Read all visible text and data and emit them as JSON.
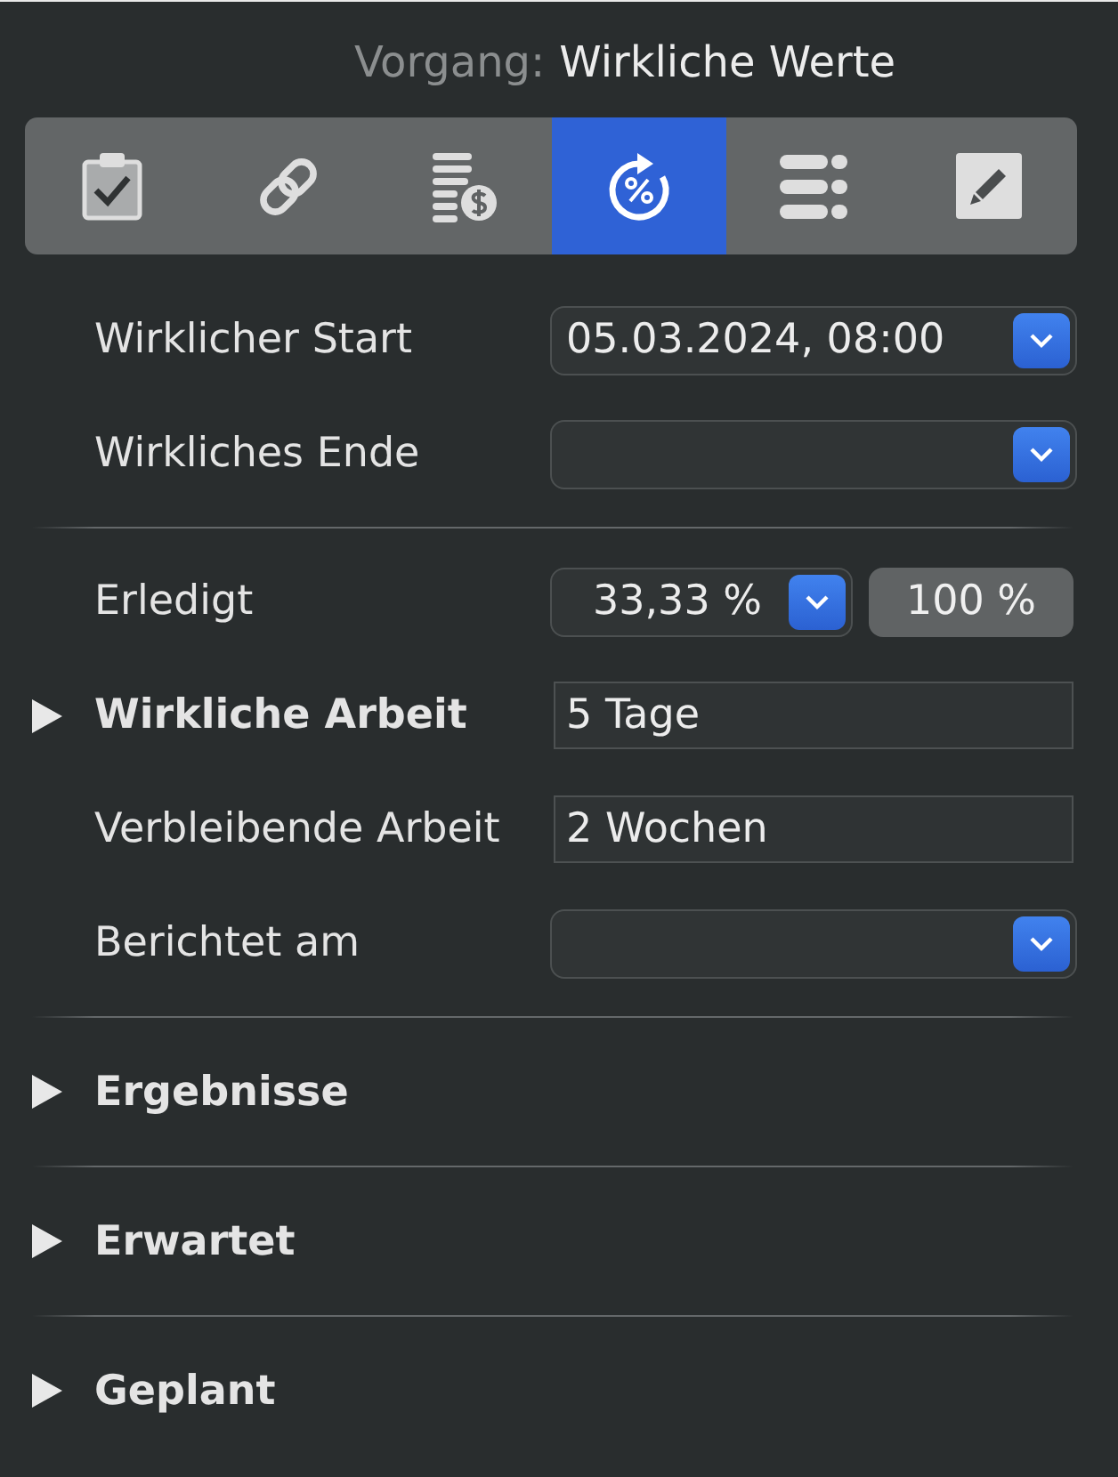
{
  "header": {
    "label": "Vorgang:",
    "title": "Wirkliche Werte"
  },
  "toolbar": {
    "tabs": [
      {
        "selected": false
      },
      {
        "selected": false
      },
      {
        "selected": false
      },
      {
        "selected": true
      },
      {
        "selected": false
      },
      {
        "selected": false
      }
    ]
  },
  "groups": [
    {
      "rows": [
        {
          "kind": "date",
          "label": "Wirklicher Start",
          "value": "05.03.2024, 08:00"
        },
        {
          "kind": "date",
          "label": "Wirkliches Ende"
        }
      ]
    },
    {
      "rows": [
        {
          "kind": "percent",
          "label": "Erledigt",
          "value": "33,33 %",
          "button": "100 %"
        },
        {
          "kind": "text",
          "label": "Wirkliche Arbeit",
          "value": "5 Tage",
          "expanded": false
        },
        {
          "kind": "text",
          "label": "Verbleibende Arbeit",
          "value": "2 Wochen"
        },
        {
          "kind": "date",
          "label": "Berichtet am"
        }
      ]
    }
  ],
  "sections": [
    {
      "label": "Ergebnisse",
      "expanded": false
    },
    {
      "label": "Erwartet",
      "expanded": false
    },
    {
      "label": "Geplant",
      "expanded": false
    }
  ]
}
